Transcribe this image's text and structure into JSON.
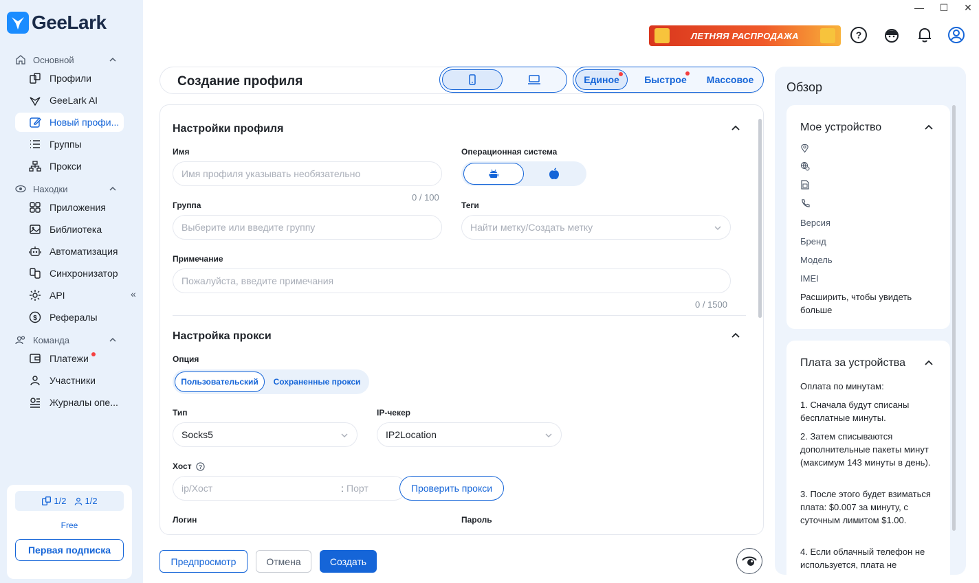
{
  "app": {
    "name": "GeeLark"
  },
  "window_controls": {
    "minimize": "—",
    "maximize": "☐",
    "close": "✕"
  },
  "promo": {
    "label": "ЛЕТНЯЯ РАСПРОДАЖА"
  },
  "sidebar": {
    "sections": [
      {
        "label": "Основной",
        "icon": "home-icon"
      },
      {
        "label": "Находки",
        "icon": "eye-icon"
      },
      {
        "label": "Команда",
        "icon": "team-icon"
      }
    ],
    "items": [
      {
        "label": "Профили",
        "icon": "profiles-icon"
      },
      {
        "label": "GeeLark AI",
        "icon": "ai-icon"
      },
      {
        "label": "Новый профи...",
        "icon": "edit-icon"
      },
      {
        "label": "Группы",
        "icon": "list-icon"
      },
      {
        "label": "Прокси",
        "icon": "network-icon"
      },
      {
        "label": "Приложения",
        "icon": "apps-icon"
      },
      {
        "label": "Библиотека",
        "icon": "library-icon"
      },
      {
        "label": "Автоматизация",
        "icon": "robot-icon"
      },
      {
        "label": "Синхронизатор",
        "icon": "sync-icon"
      },
      {
        "label": "API",
        "icon": "api-icon"
      },
      {
        "label": "Рефералы",
        "icon": "dollar-icon"
      },
      {
        "label": "Платежи",
        "icon": "wallet-icon"
      },
      {
        "label": "Участники",
        "icon": "user-icon"
      },
      {
        "label": "Журналы опе...",
        "icon": "log-icon"
      }
    ],
    "collapse": "«",
    "plan": {
      "profiles_usage": "1/2",
      "members_usage": "1/2",
      "name": "Free",
      "button": "Первая подписка"
    }
  },
  "header": {
    "title": "Создание профиля",
    "modes": [
      "Единое",
      "Быстрое",
      "Массовое"
    ],
    "selected_device": "phone",
    "selected_mode": "Единое"
  },
  "form": {
    "profile_settings": {
      "title": "Настройки профиля",
      "name_label": "Имя",
      "name_placeholder": "Имя профиля указывать необязательно",
      "name_counter": "0 / 100",
      "os_label": "Операционная система",
      "os_selected": "android",
      "group_label": "Группа",
      "group_placeholder": "Выберите или введите группу",
      "tags_label": "Теги",
      "tags_placeholder": "Найти метку/Создать метку",
      "note_label": "Примечание",
      "note_placeholder": "Пожалуйста, введите примечания",
      "note_counter": "0 / 1500"
    },
    "proxy_settings": {
      "title": "Настройка прокси",
      "option_label": "Опция",
      "options": [
        "Пользовательский",
        "Сохраненные прокси"
      ],
      "option_selected": "Пользовательский",
      "type_label": "Тип",
      "type_value": "Socks5",
      "checker_label": "IP-чекер",
      "checker_value": "IP2Location",
      "host_label": "Хост",
      "host_placeholder": "ip/Хост",
      "port_separator": ":",
      "port_placeholder": "Порт",
      "check_button": "Проверить прокси",
      "login_label": "Логин",
      "password_label": "Пароль"
    }
  },
  "footer": {
    "preview": "Предпросмотр",
    "cancel": "Отмена",
    "create": "Создать"
  },
  "overview": {
    "title": "Обзор",
    "my_device": {
      "title": "Мое устройство",
      "fields": [
        "Версия",
        "Бренд",
        "Модель",
        "IMEI"
      ],
      "expand_hint": "Расширить, чтобы увидеть больше"
    },
    "billing": {
      "title": "Плата за устройства",
      "heading": "Оплата по минутам:",
      "items": [
        "1. Сначала будут списаны бесплатные минуты.",
        "2. Затем списываются дополнительные пакеты минут (максимум 143 минуты в день).",
        "3. После этого будет взиматься плата: $0.007 за минуту, с суточным лимитом $1.00.",
        "4. Если облачный телефон не используется, плата не"
      ]
    }
  },
  "colors": {
    "accent": "#1565d8",
    "sidebar_bg": "#e9f1fb",
    "notification": "#f53f3f"
  }
}
